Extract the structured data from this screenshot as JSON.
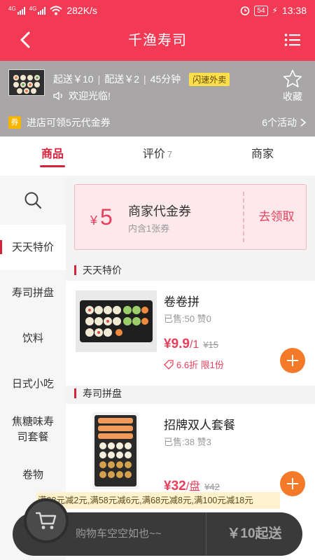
{
  "status_bar": {
    "network_label": "4G",
    "speed": "282K/s",
    "battery": "54",
    "time": "13:38"
  },
  "nav": {
    "title": "千渔寿司",
    "back_icon": "back-arrow-icon",
    "menu_icon": "list-menu-icon"
  },
  "shop": {
    "min_order": "起送￥10",
    "delivery_fee": "配送￥2",
    "delivery_time": "45分钟",
    "flash_tag": "闪速外卖",
    "welcome": "欢迎光临!",
    "favorite_label": "收藏",
    "coupon_badge": "券",
    "promo_text": "进店可领5元代金券",
    "activities": "6个活动"
  },
  "tabs": [
    {
      "label": "商品",
      "count": ""
    },
    {
      "label": "评价",
      "count": "7"
    },
    {
      "label": "商家",
      "count": ""
    }
  ],
  "sidebar": {
    "items": [
      {
        "label": "天天特价"
      },
      {
        "label": "寿司拼盘"
      },
      {
        "label": "饮料"
      },
      {
        "label": "日式小吃"
      },
      {
        "label": "焦糖味寿司套餐"
      },
      {
        "label": "卷物"
      }
    ]
  },
  "voucher": {
    "currency": "¥",
    "amount": "5",
    "title": "商家代金券",
    "subtitle": "内含1张券",
    "claim_label": "去领取"
  },
  "sections": [
    {
      "title": "天天特价",
      "products": [
        {
          "name": "卷卷拼",
          "sales": "已售:50 赞0",
          "price": "¥9.9",
          "unit": "/1",
          "old_price": "¥15",
          "discount": "6.6折 限1份"
        }
      ]
    },
    {
      "title": "寿司拼盘",
      "products": [
        {
          "name": "招牌双人套餐",
          "sales": "已售:38 赞3",
          "price": "¥32",
          "unit": "/盘",
          "old_price": "¥42",
          "discount": ""
        }
      ]
    }
  ],
  "discount_strip": "满38元减2元,满58元减6元,满68元减8元,满100元减18元",
  "cart": {
    "empty_text": "购物车空空如也~~",
    "min_order_label": "￥10起送"
  },
  "colors": {
    "brand": "#f23a55",
    "price": "#e8405c",
    "add_button": "#f47a2a",
    "flash_tag": "#ffe04a"
  }
}
